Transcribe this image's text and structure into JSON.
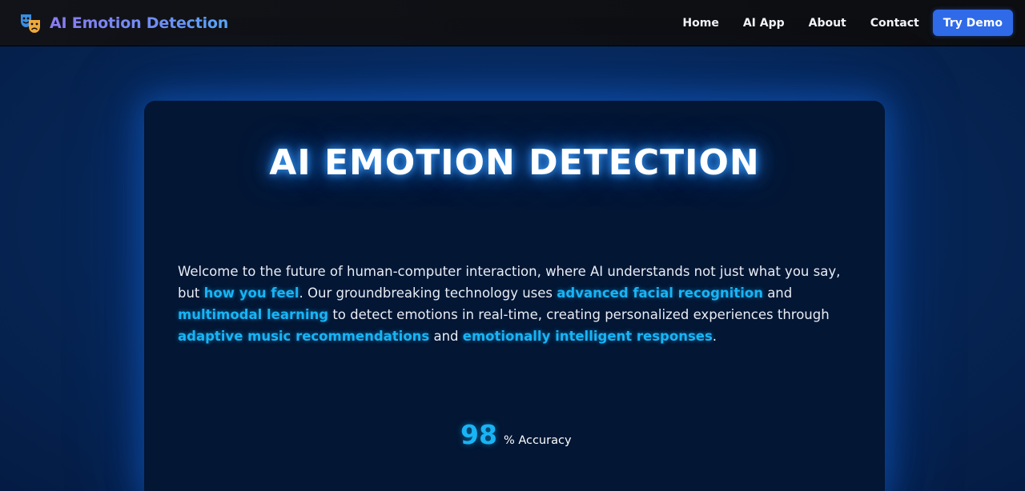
{
  "navbar": {
    "brand_icon": "theater-masks-icon",
    "brand_title": "AI Emotion Detection",
    "links": [
      {
        "label": "Home"
      },
      {
        "label": "AI App"
      },
      {
        "label": "About"
      },
      {
        "label": "Contact"
      }
    ],
    "cta_label": "Try Demo"
  },
  "hero": {
    "title": "AI EMOTION DETECTION",
    "paragraph": {
      "p1": "Welcome to the future of human-computer interaction, where AI understands not just what you say, but ",
      "h1": "how you feel",
      "p2": ". Our groundbreaking technology uses ",
      "h2": "advanced facial recognition",
      "p3": " and ",
      "h3": "multimodal learning",
      "p4": " to detect emotions in real-time, creating personalized experiences through ",
      "h4": "adaptive music recommendations",
      "p5": " and ",
      "h5": "emotionally intelligent responses",
      "p6": "."
    },
    "stat": {
      "number": "98",
      "label": "% Accuracy"
    }
  },
  "colors": {
    "accent": "#18b4f5",
    "cta": "#2f6ae8",
    "navbar_bg": "#0f1115",
    "card_bg": "#031634"
  }
}
